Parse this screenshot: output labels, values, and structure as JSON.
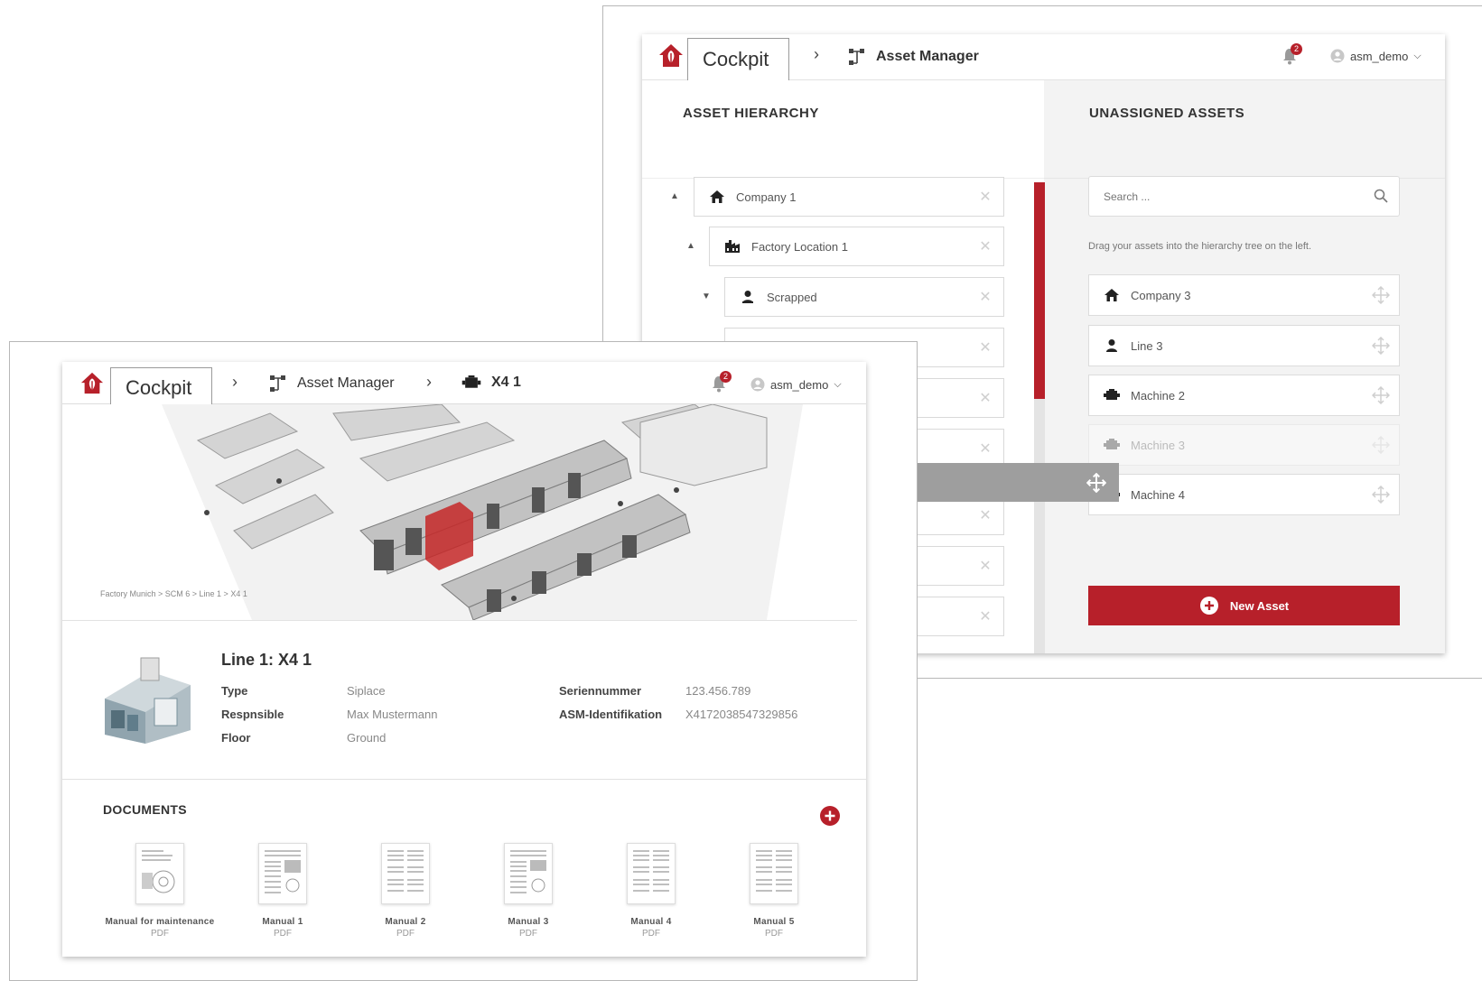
{
  "colors": {
    "brand_red": "#b7202a",
    "scroll_gray": "#e4e4e4",
    "drag_gray": "#9e9e9e"
  },
  "back": {
    "header": {
      "cockpit": "Cockpit",
      "sep": "›",
      "asset_manager": "Asset Manager",
      "notification_count": "2",
      "user": "asm_demo"
    },
    "hierarchy": {
      "title": "ASSET HIERARCHY",
      "items": [
        {
          "label": "Company 1",
          "icon": "home-icon"
        },
        {
          "label": "Factory Location 1",
          "icon": "factory-icon"
        },
        {
          "label": "Scrapped",
          "icon": "person-icon"
        }
      ]
    },
    "unassigned": {
      "title": "UNASSIGNED ASSETS",
      "search_placeholder": "Search ...",
      "hint": "Drag your assets into the hierarchy tree on the left.",
      "items": [
        {
          "label": "Company 3",
          "icon": "home-icon"
        },
        {
          "label": "Line 3",
          "icon": "person-icon"
        },
        {
          "label": "Machine 2",
          "icon": "machine-icon"
        },
        {
          "label": "Machine 3",
          "icon": "machine-icon"
        },
        {
          "label": "Machine 4",
          "icon": "machine-icon"
        }
      ],
      "new_asset": "New Asset"
    }
  },
  "front": {
    "header": {
      "cockpit": "Cockpit",
      "sep": "›",
      "asset_manager": "Asset Manager",
      "current": "X4 1",
      "notification_count": "2",
      "user": "asm_demo"
    },
    "hero_breadcrumb": "Factory Munich > SCM 6 > Line 1 > X4 1",
    "asset": {
      "title": "Line 1: X4 1",
      "fields": [
        {
          "label": "Type",
          "value": "Siplace"
        },
        {
          "label": "Respnsible",
          "value": "Max Mustermann"
        },
        {
          "label": "Floor",
          "value": "Ground"
        }
      ],
      "fields_right": [
        {
          "label": "Seriennummer",
          "value": "123.456.789"
        },
        {
          "label": "ASM-Identifikation",
          "value": "X4172038547329856"
        }
      ]
    },
    "documents": {
      "title": "DOCUMENTS",
      "items": [
        {
          "name": "Manual for maintenance",
          "ext": "PDF"
        },
        {
          "name": "Manual 1",
          "ext": "PDF"
        },
        {
          "name": "Manual 2",
          "ext": "PDF"
        },
        {
          "name": "Manual 3",
          "ext": "PDF"
        },
        {
          "name": "Manual 4",
          "ext": "PDF"
        },
        {
          "name": "Manual 5",
          "ext": "PDF"
        }
      ]
    }
  }
}
